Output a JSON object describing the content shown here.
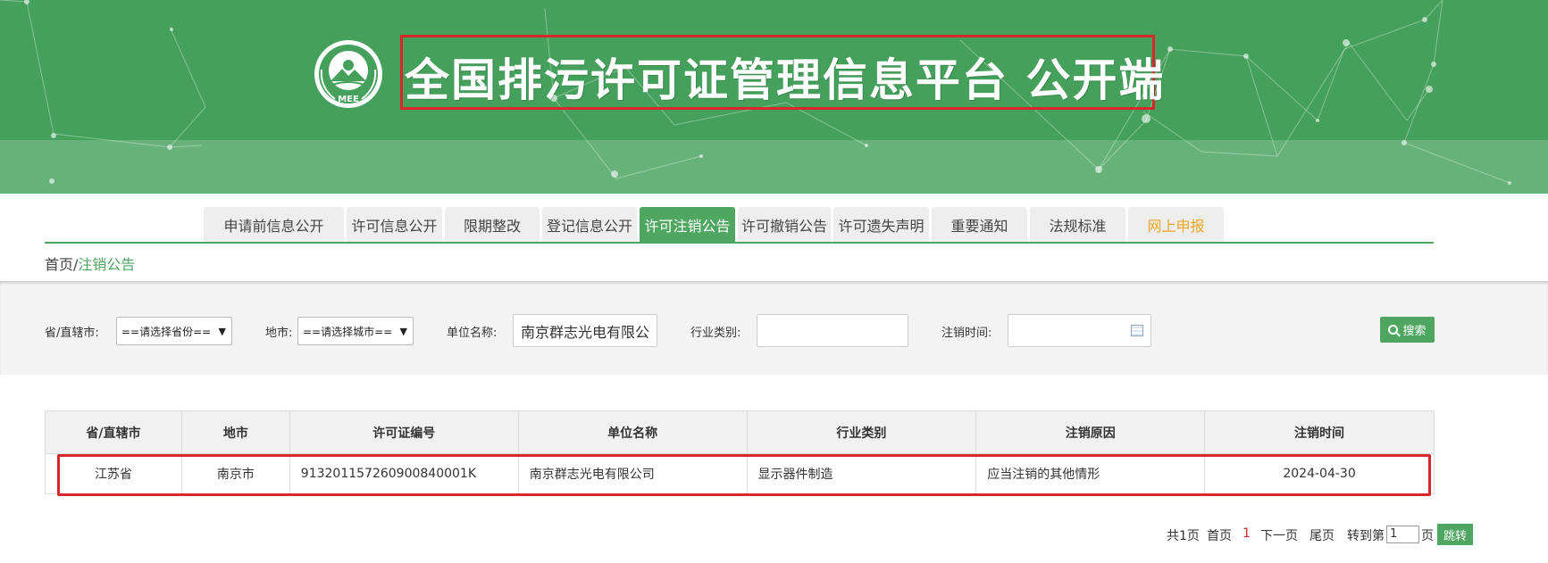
{
  "header": {
    "title": "全国排污许可证管理信息平台 公开端",
    "logo_text": "MEE"
  },
  "nav": {
    "items": [
      {
        "label": "申请前信息公开"
      },
      {
        "label": "许可信息公开"
      },
      {
        "label": "限期整改"
      },
      {
        "label": "登记信息公开"
      },
      {
        "label": "许可注销公告",
        "active": true
      },
      {
        "label": "许可撤销公告"
      },
      {
        "label": "许可遗失声明"
      },
      {
        "label": "重要通知"
      },
      {
        "label": "法规标准"
      },
      {
        "label": "网上申报",
        "highlight_color": "#f0a526"
      }
    ]
  },
  "breadcrumb": {
    "home": "首页",
    "separator": "/",
    "current": "注销公告"
  },
  "filter": {
    "province_label": "省/直辖市:",
    "province_value": "==请选择省份==",
    "city_label": "地市:",
    "city_value": "==请选择城市==",
    "unit_label": "单位名称:",
    "unit_value": "南京群志光电有限公",
    "industry_label": "行业类别:",
    "industry_value": "",
    "date_label": "注销时间:",
    "date_value": "",
    "search_button": "搜索"
  },
  "table": {
    "columns": [
      "省/直辖市",
      "地市",
      "许可证编号",
      "单位名称",
      "行业类别",
      "注销原因",
      "注销时间"
    ],
    "rows": [
      {
        "province": "江苏省",
        "city": "南京市",
        "license_no": "91320115726090084000​1K",
        "unit": "南京群志光电有限公司",
        "industry": "显示器件制造",
        "reason": "应当注销的其他情形",
        "date": "2024-04-30"
      }
    ]
  },
  "pagination": {
    "total": "共1页",
    "first": "首页",
    "current": "1",
    "next": "下一页",
    "last": "尾页",
    "goto_prefix": "转到第",
    "goto_value": "1",
    "goto_suffix": "页",
    "go_button": "跳转"
  },
  "colors": {
    "brand_green": "#44a05a",
    "nav_active": "#4ea660",
    "highlight_red": "#d9262c",
    "nav_orange": "#f0a526"
  }
}
